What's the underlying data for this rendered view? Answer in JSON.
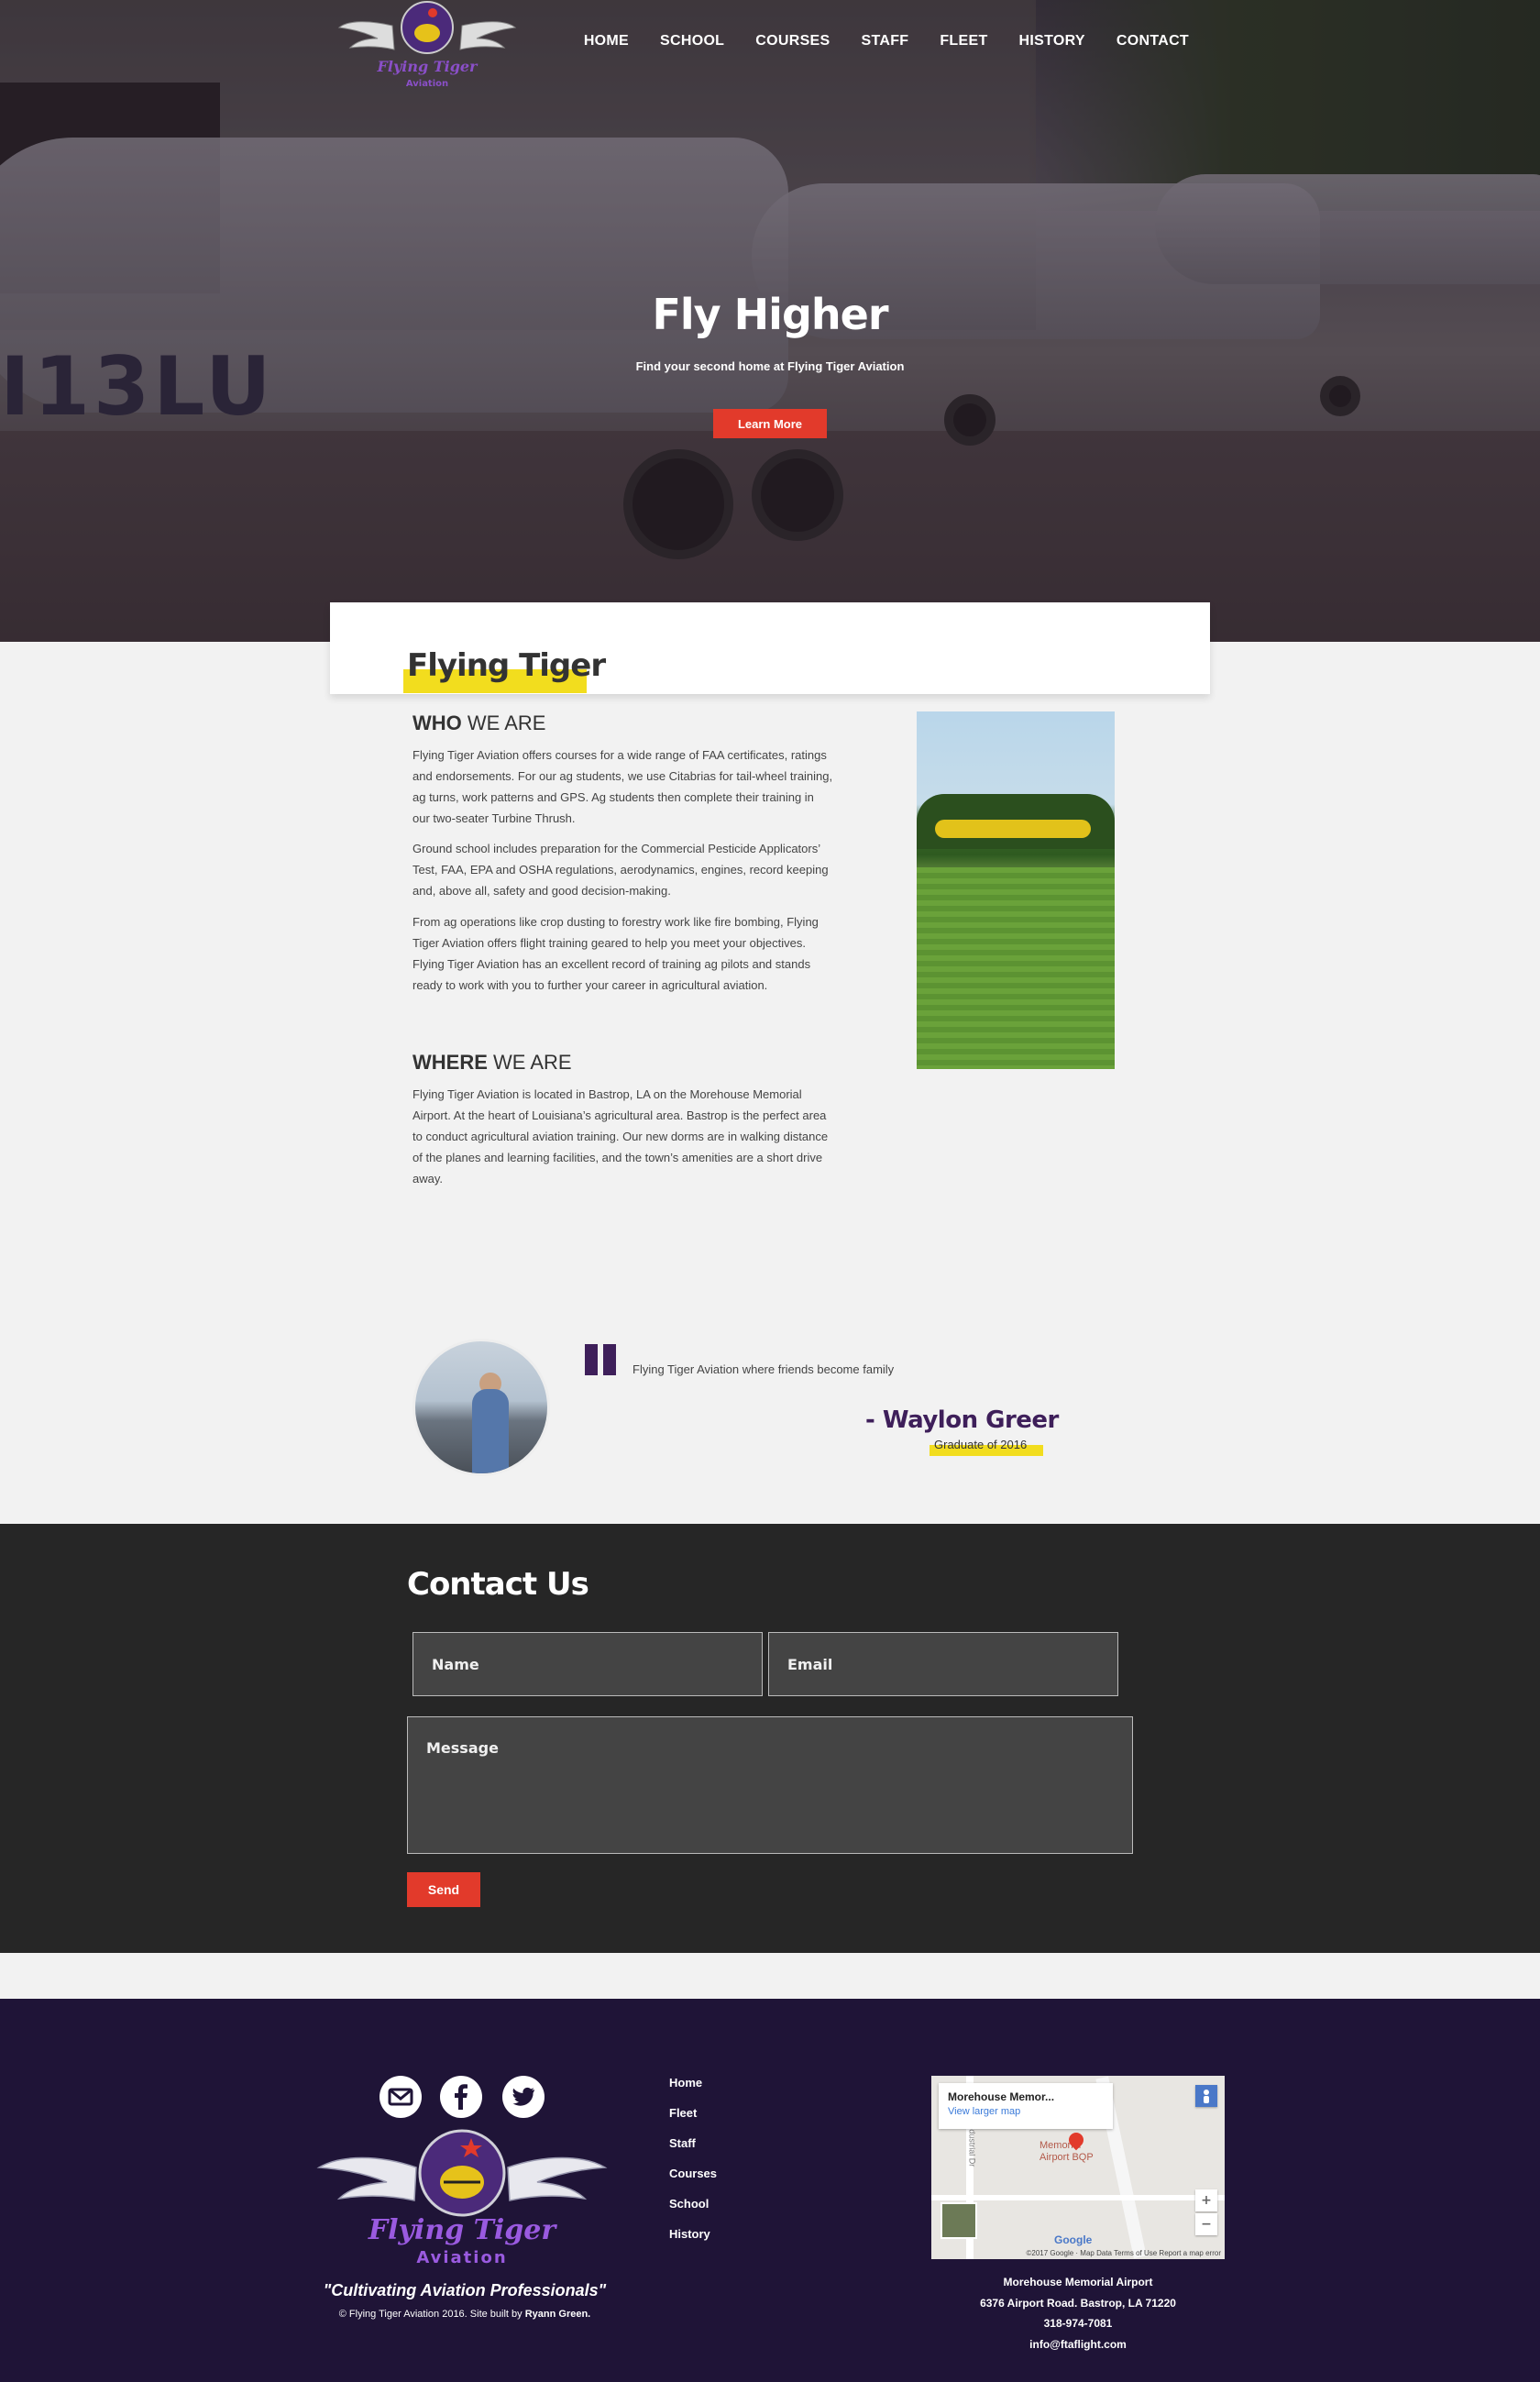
{
  "nav": {
    "logo_alt": "Flying Tiger Aviation",
    "items": [
      "HOME",
      "SCHOOL",
      "COURSES",
      "STAFF",
      "FLEET",
      "HISTORY",
      "CONTACT"
    ]
  },
  "hero": {
    "registration": "I13LU",
    "title": "Fly Higher",
    "subtitle": "Find your second home at Flying Tiger Aviation",
    "button": "Learn More"
  },
  "about": {
    "title": "Flying Tiger",
    "who": {
      "bold": "WHO",
      "rest": " WE ARE"
    },
    "who_paragraphs": [
      "Flying Tiger Aviation offers courses for a wide range of FAA certificates, ratings and endorsements. For our ag students, we use Citabrias for tail-wheel training, ag turns, work patterns and GPS. Ag students then complete their training in our two-seater Turbine Thrush.",
      "Ground school includes preparation for the Commercial Pesticide Applicators’ Test, FAA, EPA and OSHA regulations, aerodynamics, engines, record keeping and, above all, safety and good decision-making.",
      "From ag operations like crop dusting to forestry work like fire bombing, Flying Tiger Aviation offers flight training geared to help you meet your objectives. Flying Tiger Aviation has an excellent record of training ag pilots and stands ready to work with you to further your career in agricultural aviation."
    ],
    "where": {
      "bold": "WHERE",
      "rest": " WE ARE"
    },
    "where_paragraph": "Flying Tiger Aviation is located in Bastrop, LA on the Morehouse Memorial Airport. At the heart of Louisiana’s agricultural area. Bastrop is the perfect area to conduct agricultural aviation training. Our new dorms are in walking distance of the planes and learning facilities, and the town’s amenities are a short drive away."
  },
  "testimonial": {
    "quote": "Flying Tiger Aviation where friends become family",
    "author": "- Waylon Greer",
    "role": "Graduate of 2016"
  },
  "contact": {
    "title": "Contact Us",
    "name_placeholder": "Name",
    "email_placeholder": "Email",
    "message_placeholder": "Message",
    "send": "Send"
  },
  "footer": {
    "social": [
      "email-icon",
      "facebook-icon",
      "twitter-icon"
    ],
    "logo_text_1": "Flying Tiger",
    "logo_text_2": "Aviation",
    "tagline": "\"Cultivating Aviation Professionals\"",
    "copyright": "© Flying Tiger Aviation 2016. Site built by ",
    "builder": "Ryann Green.",
    "links": [
      "Home",
      "Fleet",
      "Staff",
      "Courses",
      "School",
      "History"
    ],
    "map": {
      "title": "Morehouse Memor...",
      "link": "View larger map",
      "label_1": "Memorial",
      "label_2": "Airport BQP",
      "road": "Industrial Dr",
      "google": "Google",
      "attribution": "©2017 Google · Map Data    Terms of Use    Report a map error",
      "zoom_in": "+",
      "zoom_out": "−"
    },
    "address": {
      "name": "Morehouse Memorial Airport",
      "street": "6376 Airport Road. Bastrop, LA 71220",
      "phone": "318-974-7081",
      "email": "info@ftaflight.com"
    }
  },
  "colors": {
    "accent_red": "#e23a2b",
    "highlight_yellow": "#f2dd1e",
    "brand_purple": "#3e1f5a",
    "footer_bg": "#1f1437",
    "contact_bg": "#262626"
  }
}
